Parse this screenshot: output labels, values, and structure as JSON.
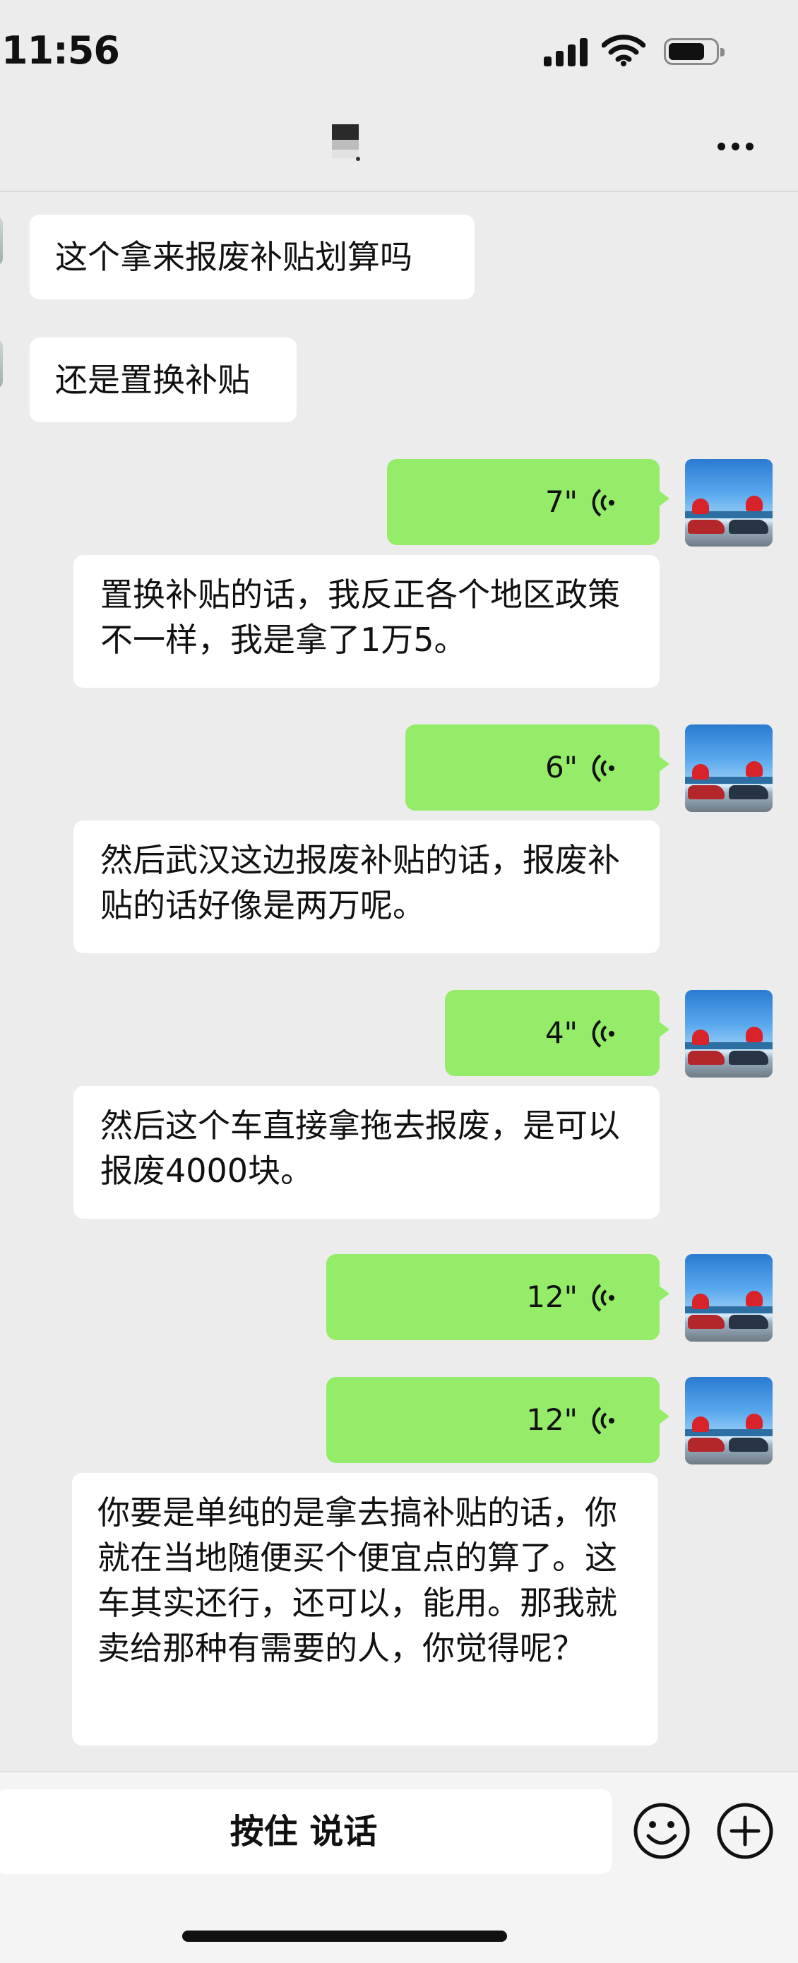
{
  "status_bar": {
    "time": "11:56"
  },
  "nav": {
    "more_icon": "more-icon"
  },
  "messages_incoming": [
    {
      "text": "这个拿来报废补贴划算吗"
    },
    {
      "text": "还是置换补贴"
    }
  ],
  "voice_messages": [
    {
      "duration": "7\"",
      "transcript": "置换补贴的话，我反正各个地区政策不一样，我是拿了1万5。"
    },
    {
      "duration": "6\"",
      "transcript": "然后武汉这边报废补贴的话，报废补贴的话好像是两万呢。"
    },
    {
      "duration": "4\"",
      "transcript": "然后这个车直接拿拖去报废，是可以报废4000块。"
    },
    {
      "duration": "12\""
    },
    {
      "duration": "12\"",
      "transcript": "你要是单纯的是拿去搞补贴的话，你就在当地随便买个便宜点的算了。这车其实还行，还可以，能用。那我就卖给那种有需要的人，你觉得呢？"
    }
  ],
  "input_bar": {
    "hold_to_talk": "按住 说话",
    "emoji_icon": "emoji-icon",
    "plus_icon": "plus-icon"
  },
  "colors": {
    "voice_bubble": "#95ec69",
    "background": "#ececec",
    "bubble": "#ffffff"
  }
}
